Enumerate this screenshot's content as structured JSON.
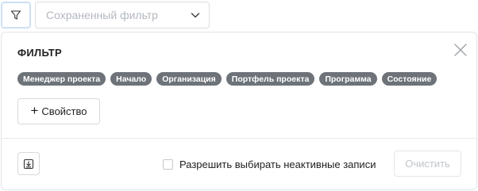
{
  "top_bar": {
    "filter_toggle_icon": "funnel-icon",
    "saved_filter": {
      "placeholder": "Сохраненный фильтр",
      "dropdown_icon": "chevron-down-icon"
    }
  },
  "panel": {
    "title": "ФИЛЬТР",
    "close_icon": "close-icon",
    "chips": [
      "Менеджер проекта",
      "Начало",
      "Организация",
      "Портфель проекта",
      "Программа",
      "Состояние"
    ],
    "add_property": {
      "plus": "+",
      "label": "Свойство"
    },
    "export_icon": "download-icon",
    "allow_inactive": {
      "label": "Разрешить выбирать неактивные записи",
      "checked": false
    },
    "clear_label": "Очистить"
  },
  "colors": {
    "chip_bg": "#6d7378",
    "focus_border": "#cfe0f5",
    "disabled_text": "#c0c4c9",
    "placeholder_text": "#b3b8bf"
  }
}
